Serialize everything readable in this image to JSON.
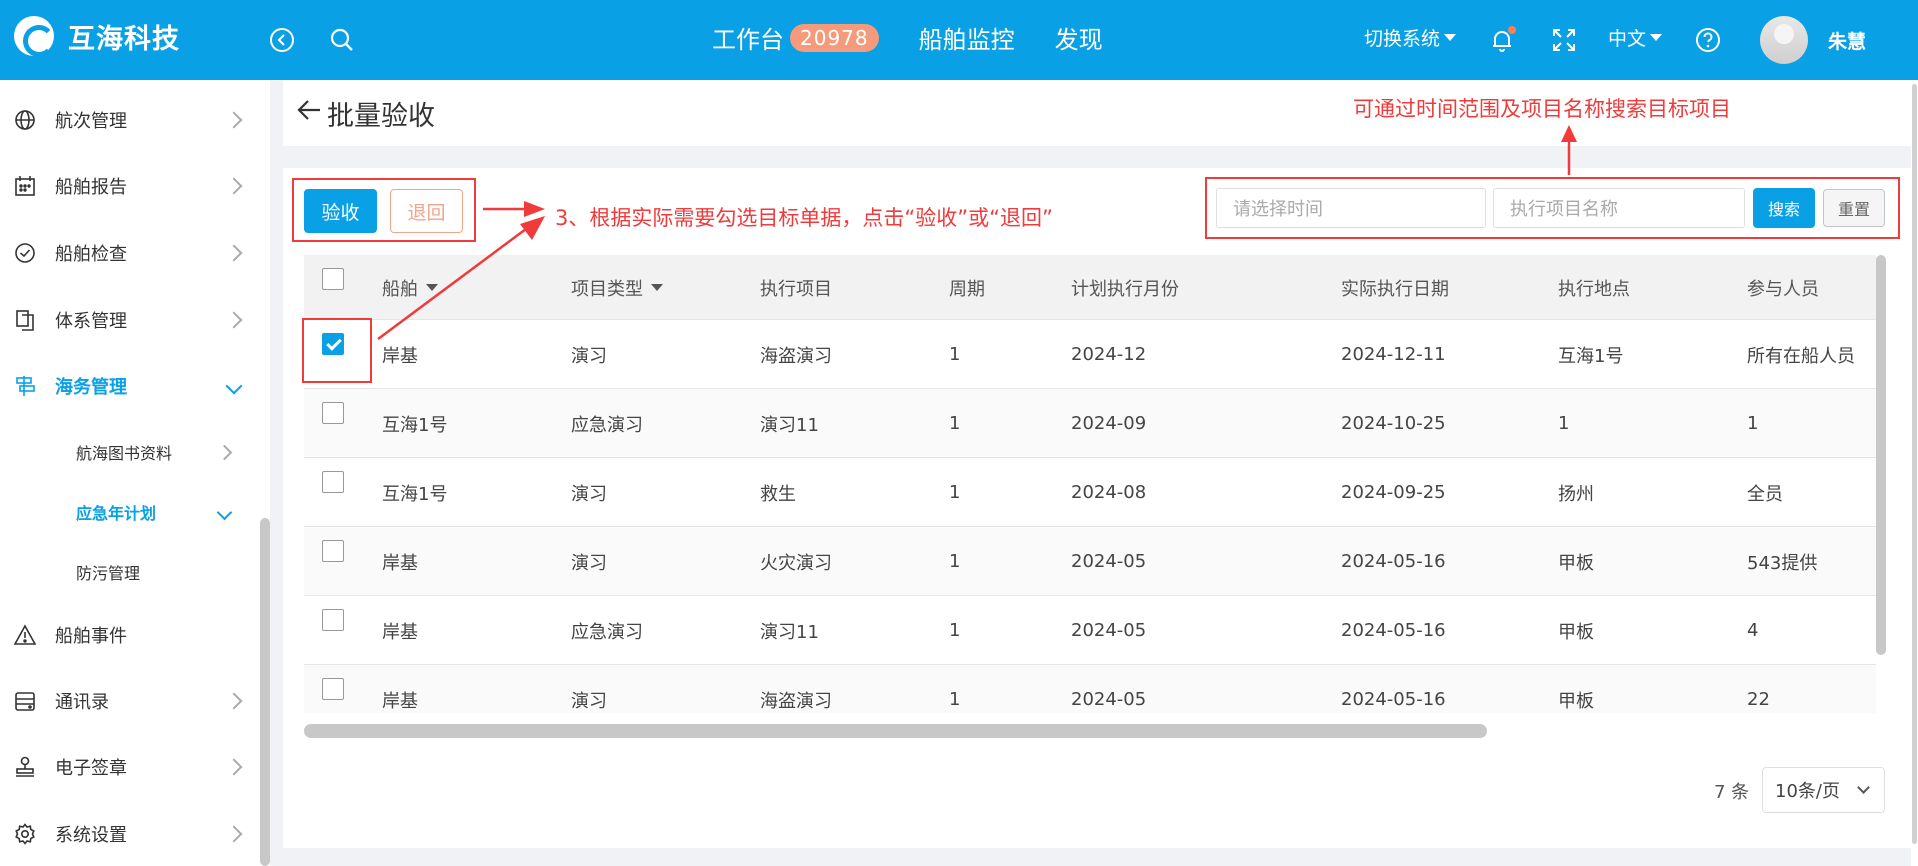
{
  "header": {
    "brand": "互海科技",
    "nav": [
      {
        "label": "工作台",
        "badge": "20978"
      },
      {
        "label": "船舶监控"
      },
      {
        "label": "发现"
      }
    ],
    "switch_system": "切换系统",
    "language": "中文",
    "username": "朱慧",
    "icons": [
      "back-circle-icon",
      "search-icon",
      "bell-icon",
      "fullscreen-icon",
      "help-icon"
    ],
    "accent": "#0aa0e6"
  },
  "sidebar": {
    "items": [
      {
        "label": "航次管理",
        "icon": "globe-icon"
      },
      {
        "label": "船舶报告",
        "icon": "calendar-icon"
      },
      {
        "label": "船舶检查",
        "icon": "check-circle-icon"
      },
      {
        "label": "体系管理",
        "icon": "document-copy-icon"
      },
      {
        "label": "海务管理",
        "icon": "signpost-icon",
        "expanded": true
      },
      {
        "label": "船舶事件",
        "icon": "warning-icon"
      },
      {
        "label": "通讯录",
        "icon": "address-book-icon"
      },
      {
        "label": "电子签章",
        "icon": "stamp-icon"
      },
      {
        "label": "系统设置",
        "icon": "gear-icon"
      }
    ],
    "subitems": [
      {
        "label": "航海图书资料"
      },
      {
        "label": "应急年计划",
        "expanded": true
      },
      {
        "label": "防污管理"
      }
    ]
  },
  "page": {
    "title": "批量验收"
  },
  "toolbar": {
    "accept_label": "验收",
    "return_label": "退回",
    "time_placeholder": "请选择时间",
    "project_placeholder": "执行项目名称",
    "search_label": "搜索",
    "reset_label": "重置"
  },
  "table": {
    "headers": [
      "船舶",
      "项目类型",
      "执行项目",
      "周期",
      "计划执行月份",
      "实际执行日期",
      "执行地点",
      "参与人员"
    ],
    "rows": [
      {
        "checked": true,
        "cells": [
          "岸基",
          "演习",
          "海盗演习",
          "1",
          "2024-12",
          "2024-12-11",
          "互海1号",
          "所有在船人员"
        ]
      },
      {
        "checked": false,
        "cells": [
          "互海1号",
          "应急演习",
          "演习11",
          "1",
          "2024-09",
          "2024-10-25",
          "1",
          "1"
        ]
      },
      {
        "checked": false,
        "cells": [
          "互海1号",
          "演习",
          "救生",
          "1",
          "2024-08",
          "2024-09-25",
          "扬州",
          "全员"
        ]
      },
      {
        "checked": false,
        "cells": [
          "岸基",
          "演习",
          "火灾演习",
          "1",
          "2024-05",
          "2024-05-16",
          "甲板",
          "543提供"
        ]
      },
      {
        "checked": false,
        "cells": [
          "岸基",
          "应急演习",
          "演习11",
          "1",
          "2024-05",
          "2024-05-16",
          "甲板",
          "4"
        ]
      },
      {
        "checked": false,
        "cells": [
          "岸基",
          "演习",
          "海盗演习",
          "1",
          "2024-05",
          "2024-05-16",
          "甲板",
          "22"
        ]
      }
    ]
  },
  "pagination": {
    "total": "7 条",
    "page_size": "10条/页"
  },
  "annotations": {
    "search_hint": "可通过时间范围及项目名称搜索目标项目",
    "step_hint": "3、根据实际需要勾选目标单据，点击“验收”或“退回”",
    "color": "#ef3b3b"
  }
}
